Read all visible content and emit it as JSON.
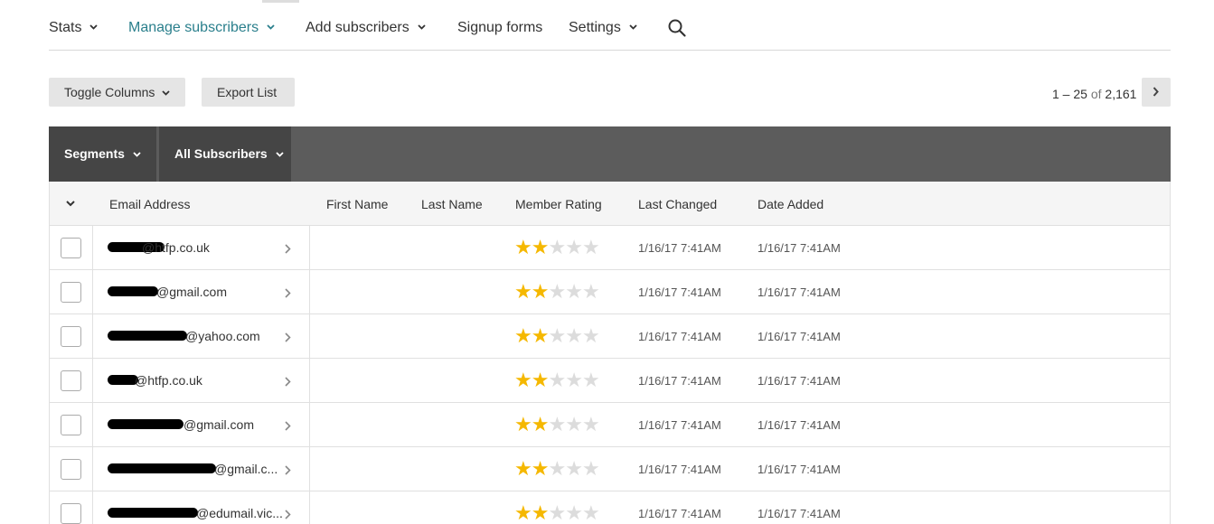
{
  "nav": {
    "items": [
      {
        "label": "Stats",
        "dropdown": true
      },
      {
        "label": "Manage subscribers",
        "dropdown": true,
        "active": true
      },
      {
        "label": "Add subscribers",
        "dropdown": true
      },
      {
        "label": "Signup forms",
        "dropdown": false
      },
      {
        "label": "Settings",
        "dropdown": true
      }
    ],
    "search_icon": "search-icon"
  },
  "toolbar": {
    "toggle_columns": "Toggle Columns",
    "export_list": "Export List"
  },
  "pager": {
    "range": "1 – 25",
    "of": "of",
    "total": "2,161"
  },
  "segments": {
    "segments_label": "Segments",
    "list_label": "All Subscribers"
  },
  "table": {
    "columns": [
      "Email Address",
      "First Name",
      "Last Name",
      "Member Rating",
      "Last Changed",
      "Date Added"
    ],
    "rows": [
      {
        "email": "@htfp.co.uk",
        "first": "",
        "last": "",
        "rating": 2,
        "changed": "1/16/17 7:41AM",
        "added": "1/16/17 7:41AM"
      },
      {
        "email": "@gmail.com",
        "first": "",
        "last": "",
        "rating": 2,
        "changed": "1/16/17 7:41AM",
        "added": "1/16/17 7:41AM"
      },
      {
        "email": "@yahoo.com",
        "first": "",
        "last": "",
        "rating": 2,
        "changed": "1/16/17 7:41AM",
        "added": "1/16/17 7:41AM"
      },
      {
        "email": "@htfp.co.uk",
        "first": "",
        "last": "",
        "rating": 2,
        "changed": "1/16/17 7:41AM",
        "added": "1/16/17 7:41AM"
      },
      {
        "email": "@gmail.com",
        "first": "",
        "last": "",
        "rating": 2,
        "changed": "1/16/17 7:41AM",
        "added": "1/16/17 7:41AM"
      },
      {
        "email": "@gmail.c...",
        "first": "",
        "last": "",
        "rating": 2,
        "changed": "1/16/17 7:41AM",
        "added": "1/16/17 7:41AM"
      },
      {
        "email": "@edumail.vic...",
        "first": "",
        "last": "",
        "rating": 2,
        "changed": "1/16/17 7:41AM",
        "added": "1/16/17 7:41AM"
      }
    ],
    "rating_max": 5
  },
  "colors": {
    "accent": "#2a7f8c",
    "star": "#f5b800",
    "segbar": "#5c5c5c"
  }
}
